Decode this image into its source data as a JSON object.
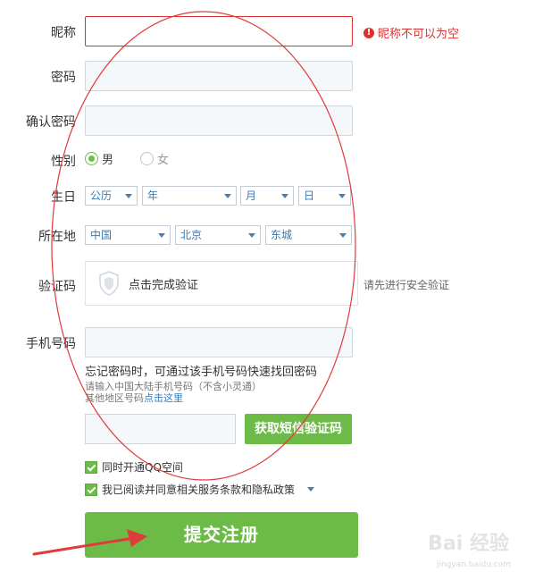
{
  "form": {
    "nickname": {
      "label": "昵称",
      "value": "",
      "error": "昵称不可以为空",
      "error_icon": "!"
    },
    "password": {
      "label": "密码",
      "value": ""
    },
    "confirm_password": {
      "label": "确认密码",
      "value": ""
    },
    "gender": {
      "label": "性别",
      "options": [
        "男",
        "女"
      ],
      "selected": "男"
    },
    "birthday": {
      "label": "生日",
      "calendar": "公历",
      "year": "年",
      "month": "月",
      "day": "日"
    },
    "location": {
      "label": "所在地",
      "country": "中国",
      "province": "北京",
      "district": "东城"
    },
    "captcha": {
      "label": "验证码",
      "button_text": "点击完成验证",
      "hint": "请先进行安全验证"
    },
    "phone": {
      "label": "手机号码",
      "value": "",
      "note": "忘记密码时，可通过该手机号码快速找回密码",
      "sub_note": "请输入中国大陆手机号码（不含小灵通）",
      "other_prefix": "其他地区号码",
      "other_link": "点击这里"
    },
    "sms": {
      "value": "",
      "button": "获取短信验证码"
    },
    "open_qzone": {
      "label": "同时开通QQ空间",
      "checked": true
    },
    "agree_terms": {
      "label": "我已阅读并同意相关服务条款和隐私政策",
      "checked": true
    },
    "submit": "提交注册"
  },
  "watermark": {
    "text": "Bai 经验",
    "sub": "jingyan.baidu.com"
  },
  "colors": {
    "accent": "#6dbb47",
    "error": "#d8322f",
    "link": "#2a7ad1",
    "annotation": "#e03b3b"
  }
}
